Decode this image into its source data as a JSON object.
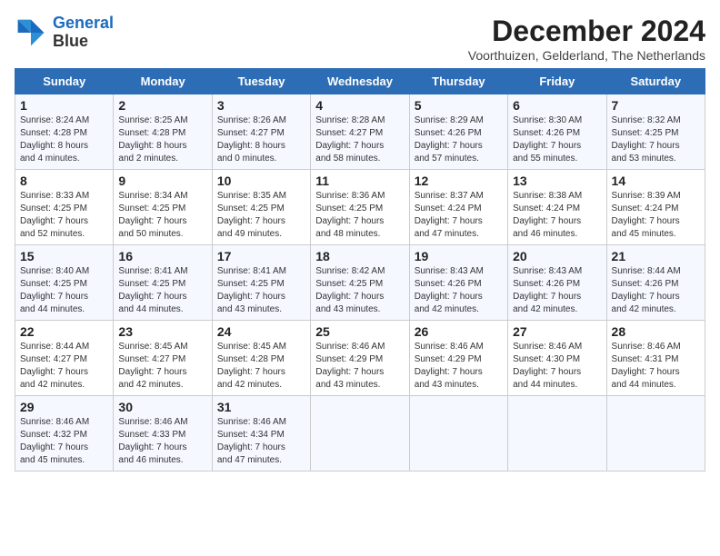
{
  "logo": {
    "line1": "General",
    "line2": "Blue"
  },
  "title": "December 2024",
  "subtitle": "Voorthuizen, Gelderland, The Netherlands",
  "days_of_week": [
    "Sunday",
    "Monday",
    "Tuesday",
    "Wednesday",
    "Thursday",
    "Friday",
    "Saturday"
  ],
  "weeks": [
    [
      {
        "day": 1,
        "info": "Sunrise: 8:24 AM\nSunset: 4:28 PM\nDaylight: 8 hours\nand 4 minutes."
      },
      {
        "day": 2,
        "info": "Sunrise: 8:25 AM\nSunset: 4:28 PM\nDaylight: 8 hours\nand 2 minutes."
      },
      {
        "day": 3,
        "info": "Sunrise: 8:26 AM\nSunset: 4:27 PM\nDaylight: 8 hours\nand 0 minutes."
      },
      {
        "day": 4,
        "info": "Sunrise: 8:28 AM\nSunset: 4:27 PM\nDaylight: 7 hours\nand 58 minutes."
      },
      {
        "day": 5,
        "info": "Sunrise: 8:29 AM\nSunset: 4:26 PM\nDaylight: 7 hours\nand 57 minutes."
      },
      {
        "day": 6,
        "info": "Sunrise: 8:30 AM\nSunset: 4:26 PM\nDaylight: 7 hours\nand 55 minutes."
      },
      {
        "day": 7,
        "info": "Sunrise: 8:32 AM\nSunset: 4:25 PM\nDaylight: 7 hours\nand 53 minutes."
      }
    ],
    [
      {
        "day": 8,
        "info": "Sunrise: 8:33 AM\nSunset: 4:25 PM\nDaylight: 7 hours\nand 52 minutes."
      },
      {
        "day": 9,
        "info": "Sunrise: 8:34 AM\nSunset: 4:25 PM\nDaylight: 7 hours\nand 50 minutes."
      },
      {
        "day": 10,
        "info": "Sunrise: 8:35 AM\nSunset: 4:25 PM\nDaylight: 7 hours\nand 49 minutes."
      },
      {
        "day": 11,
        "info": "Sunrise: 8:36 AM\nSunset: 4:25 PM\nDaylight: 7 hours\nand 48 minutes."
      },
      {
        "day": 12,
        "info": "Sunrise: 8:37 AM\nSunset: 4:24 PM\nDaylight: 7 hours\nand 47 minutes."
      },
      {
        "day": 13,
        "info": "Sunrise: 8:38 AM\nSunset: 4:24 PM\nDaylight: 7 hours\nand 46 minutes."
      },
      {
        "day": 14,
        "info": "Sunrise: 8:39 AM\nSunset: 4:24 PM\nDaylight: 7 hours\nand 45 minutes."
      }
    ],
    [
      {
        "day": 15,
        "info": "Sunrise: 8:40 AM\nSunset: 4:25 PM\nDaylight: 7 hours\nand 44 minutes."
      },
      {
        "day": 16,
        "info": "Sunrise: 8:41 AM\nSunset: 4:25 PM\nDaylight: 7 hours\nand 44 minutes."
      },
      {
        "day": 17,
        "info": "Sunrise: 8:41 AM\nSunset: 4:25 PM\nDaylight: 7 hours\nand 43 minutes."
      },
      {
        "day": 18,
        "info": "Sunrise: 8:42 AM\nSunset: 4:25 PM\nDaylight: 7 hours\nand 43 minutes."
      },
      {
        "day": 19,
        "info": "Sunrise: 8:43 AM\nSunset: 4:26 PM\nDaylight: 7 hours\nand 42 minutes."
      },
      {
        "day": 20,
        "info": "Sunrise: 8:43 AM\nSunset: 4:26 PM\nDaylight: 7 hours\nand 42 minutes."
      },
      {
        "day": 21,
        "info": "Sunrise: 8:44 AM\nSunset: 4:26 PM\nDaylight: 7 hours\nand 42 minutes."
      }
    ],
    [
      {
        "day": 22,
        "info": "Sunrise: 8:44 AM\nSunset: 4:27 PM\nDaylight: 7 hours\nand 42 minutes."
      },
      {
        "day": 23,
        "info": "Sunrise: 8:45 AM\nSunset: 4:27 PM\nDaylight: 7 hours\nand 42 minutes."
      },
      {
        "day": 24,
        "info": "Sunrise: 8:45 AM\nSunset: 4:28 PM\nDaylight: 7 hours\nand 42 minutes."
      },
      {
        "day": 25,
        "info": "Sunrise: 8:46 AM\nSunset: 4:29 PM\nDaylight: 7 hours\nand 43 minutes."
      },
      {
        "day": 26,
        "info": "Sunrise: 8:46 AM\nSunset: 4:29 PM\nDaylight: 7 hours\nand 43 minutes."
      },
      {
        "day": 27,
        "info": "Sunrise: 8:46 AM\nSunset: 4:30 PM\nDaylight: 7 hours\nand 44 minutes."
      },
      {
        "day": 28,
        "info": "Sunrise: 8:46 AM\nSunset: 4:31 PM\nDaylight: 7 hours\nand 44 minutes."
      }
    ],
    [
      {
        "day": 29,
        "info": "Sunrise: 8:46 AM\nSunset: 4:32 PM\nDaylight: 7 hours\nand 45 minutes."
      },
      {
        "day": 30,
        "info": "Sunrise: 8:46 AM\nSunset: 4:33 PM\nDaylight: 7 hours\nand 46 minutes."
      },
      {
        "day": 31,
        "info": "Sunrise: 8:46 AM\nSunset: 4:34 PM\nDaylight: 7 hours\nand 47 minutes."
      },
      null,
      null,
      null,
      null
    ]
  ]
}
